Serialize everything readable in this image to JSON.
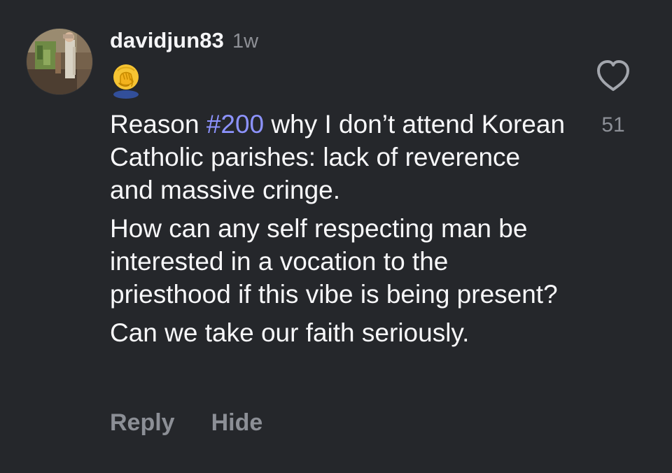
{
  "comment": {
    "username": "davidjun83",
    "timestamp": "1w",
    "reaction_emoji": "face-palm",
    "body": {
      "line1_before": "Reason ",
      "hashtag": "#200",
      "line1_after": " why I don’t attend Korean Catholic parishes: lack of reverence and massive cringe.",
      "paragraph2": "How can any self respecting man be interested in a vocation to the priesthood if this vibe is being present?",
      "paragraph3": "Can we take our faith seriously."
    },
    "likes": {
      "count": "51",
      "icon": "heart-outline-icon"
    },
    "actions": {
      "reply_label": "Reply",
      "hide_label": "Hide"
    }
  },
  "colors": {
    "background": "#25272b",
    "text": "#f5f5f7",
    "muted": "#8e9096",
    "hashtag": "#8d93ff"
  }
}
